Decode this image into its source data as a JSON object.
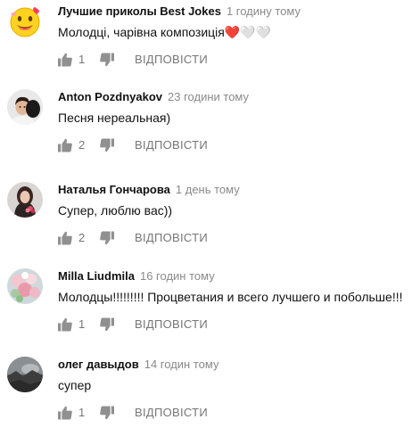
{
  "comments": [
    {
      "author": "Лучшие приколы Best Jokes",
      "time": "1 годину тому",
      "text": "Молодці, чарівна композиція❤️🤍🤍",
      "likes": "1",
      "reply": "ВІДПОВІСТИ",
      "avatar": "smiley-emoji"
    },
    {
      "author": "Anton Pozdnyakov",
      "time": "23 години тому",
      "text": "Песня нереальная)",
      "likes": "2",
      "reply": "ВІДПОВІСТИ",
      "avatar": "man-with-dark-hair"
    },
    {
      "author": "Наталья Гончарова",
      "time": "1 день тому",
      "text": "Супер, люблю вас))",
      "likes": "2",
      "reply": "ВІДПОВІСТИ",
      "avatar": "woman-with-bouquet"
    },
    {
      "author": "Milla Liudmila",
      "time": "16 годин тому",
      "text": "Молодцы!!!!!!!!! Процветания и всего лучшего и побольше!!!",
      "likes": "1",
      "reply": "ВІДПОВІСТИ",
      "avatar": "flowers"
    },
    {
      "author": "олег давыдов",
      "time": "14 годин тому",
      "text": "супер",
      "likes": "1",
      "reply": "ВІДПОВІСТИ",
      "avatar": "dark-landscape"
    }
  ]
}
